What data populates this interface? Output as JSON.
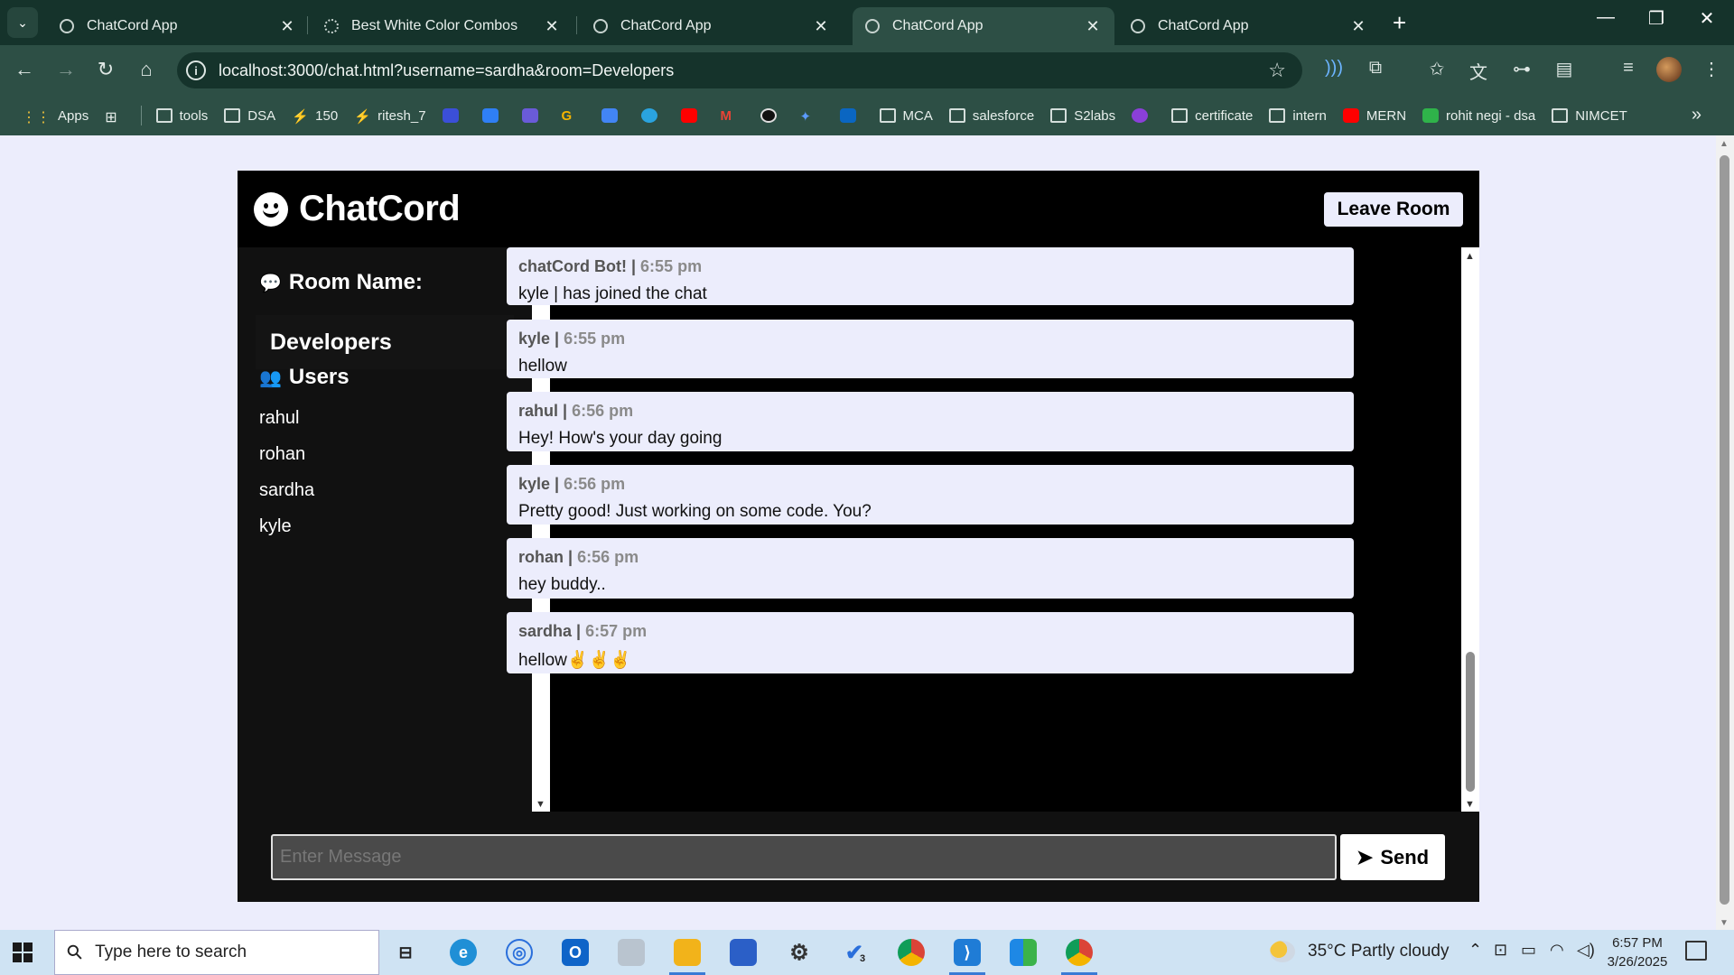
{
  "browser": {
    "tabs": [
      {
        "title": "ChatCord App",
        "active": false
      },
      {
        "title": "Best White Color Combos",
        "active": false
      },
      {
        "title": "ChatCord App",
        "active": false
      },
      {
        "title": "ChatCord App",
        "active": true
      },
      {
        "title": "ChatCord App",
        "active": false
      }
    ],
    "url": "localhost:3000/chat.html?username=sardha&room=Developers",
    "bookmarks": [
      {
        "label": "Apps",
        "icon": "apps-grid-icon"
      },
      {
        "label": "tools",
        "icon": "folder-icon"
      },
      {
        "label": "DSA",
        "icon": "folder-icon"
      },
      {
        "label": "150",
        "icon": "codestudio-icon"
      },
      {
        "label": "ritesh_7",
        "icon": "codestudio-icon"
      },
      {
        "label": "MCA",
        "icon": "folder-icon"
      },
      {
        "label": "salesforce",
        "icon": "folder-icon"
      },
      {
        "label": "S2labs",
        "icon": "folder-icon"
      },
      {
        "label": "certificate",
        "icon": "folder-icon"
      },
      {
        "label": "intern",
        "icon": "folder-icon"
      },
      {
        "label": "MERN",
        "icon": "youtube-icon"
      },
      {
        "label": "rohit negi - dsa",
        "icon": "plus-green-icon"
      },
      {
        "label": "NIMCET",
        "icon": "folder-icon"
      }
    ]
  },
  "app": {
    "title": "ChatCord",
    "leave_label": "Leave Room",
    "room_heading": "Room Name:",
    "room_name": "Developers",
    "users_heading": "Users",
    "users": [
      "rahul",
      "rohan",
      "sardha",
      "kyle"
    ],
    "messages": [
      {
        "user": "chatCord Bot!",
        "time": "6:55 pm",
        "text": "kyle | has joined the chat"
      },
      {
        "user": "kyle",
        "time": "6:55 pm",
        "text": "hellow"
      },
      {
        "user": "rahul",
        "time": "6:56 pm",
        "text": "Hey! How's your day going"
      },
      {
        "user": "kyle",
        "time": "6:56 pm",
        "text": "Pretty good! Just working on some code. You?"
      },
      {
        "user": "rohan",
        "time": "6:56 pm",
        "text": "hey buddy.."
      },
      {
        "user": "sardha",
        "time": "6:57 pm",
        "text": "hellow✌✌✌"
      }
    ],
    "input_placeholder": "Enter Message",
    "send_label": "Send"
  },
  "taskbar": {
    "search_placeholder": "Type here to search",
    "weather": "35°C  Partly cloudy",
    "time": "6:57 PM",
    "date": "3/26/2025",
    "badge_count": "3"
  }
}
